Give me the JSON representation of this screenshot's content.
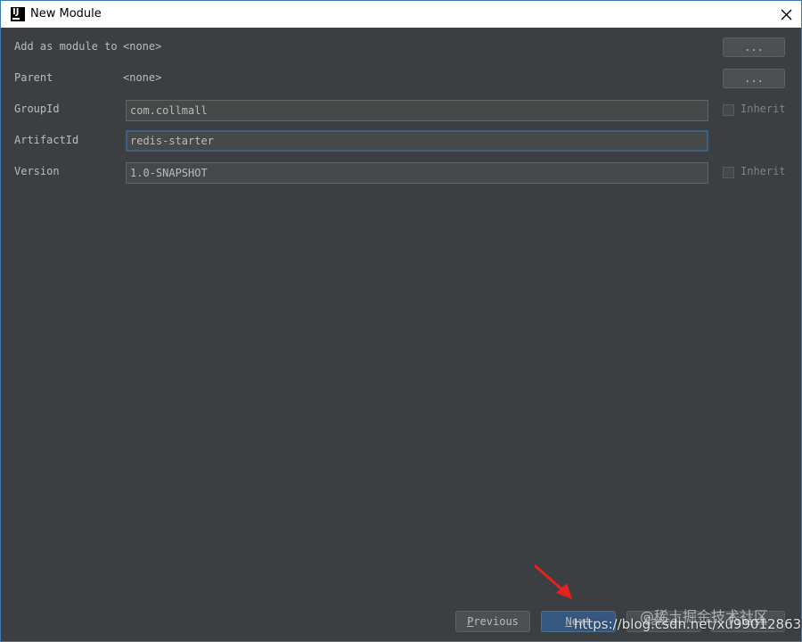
{
  "window": {
    "title": "New Module"
  },
  "form": {
    "add_as_module": {
      "label": "Add as module to",
      "value": "<none>",
      "browse_label": "..."
    },
    "parent": {
      "label": "Parent",
      "value": "<none>",
      "browse_label": "..."
    },
    "group_id": {
      "label": "GroupId",
      "value": "com.collmall",
      "inherit_label": "Inherit",
      "inherit_checked": false
    },
    "artifact_id": {
      "label": "ArtifactId",
      "value": "redis-starter"
    },
    "version": {
      "label": "Version",
      "value": "1.0-SNAPSHOT",
      "inherit_label": "Inherit",
      "inherit_checked": false
    }
  },
  "footer": {
    "previous": {
      "mnemonic": "P",
      "rest": "revious"
    },
    "next": {
      "mnemonic": "N",
      "rest": "ext"
    },
    "cancel": "Cancel",
    "finish": "Finish"
  },
  "watermark": {
    "line1": "@稀土掘金技术社区",
    "line2": "https://blog.csdn.net/xu990128638"
  },
  "colors": {
    "accent": "#3c7ab8",
    "background": "#3c3f41",
    "focus_border": "#3d6185",
    "primary_button": "#365880",
    "annotation_arrow": "#e8201f"
  },
  "icons": {
    "app": "intellij-idea-icon",
    "close": "close-icon",
    "annotation": "red-arrow-icon"
  }
}
